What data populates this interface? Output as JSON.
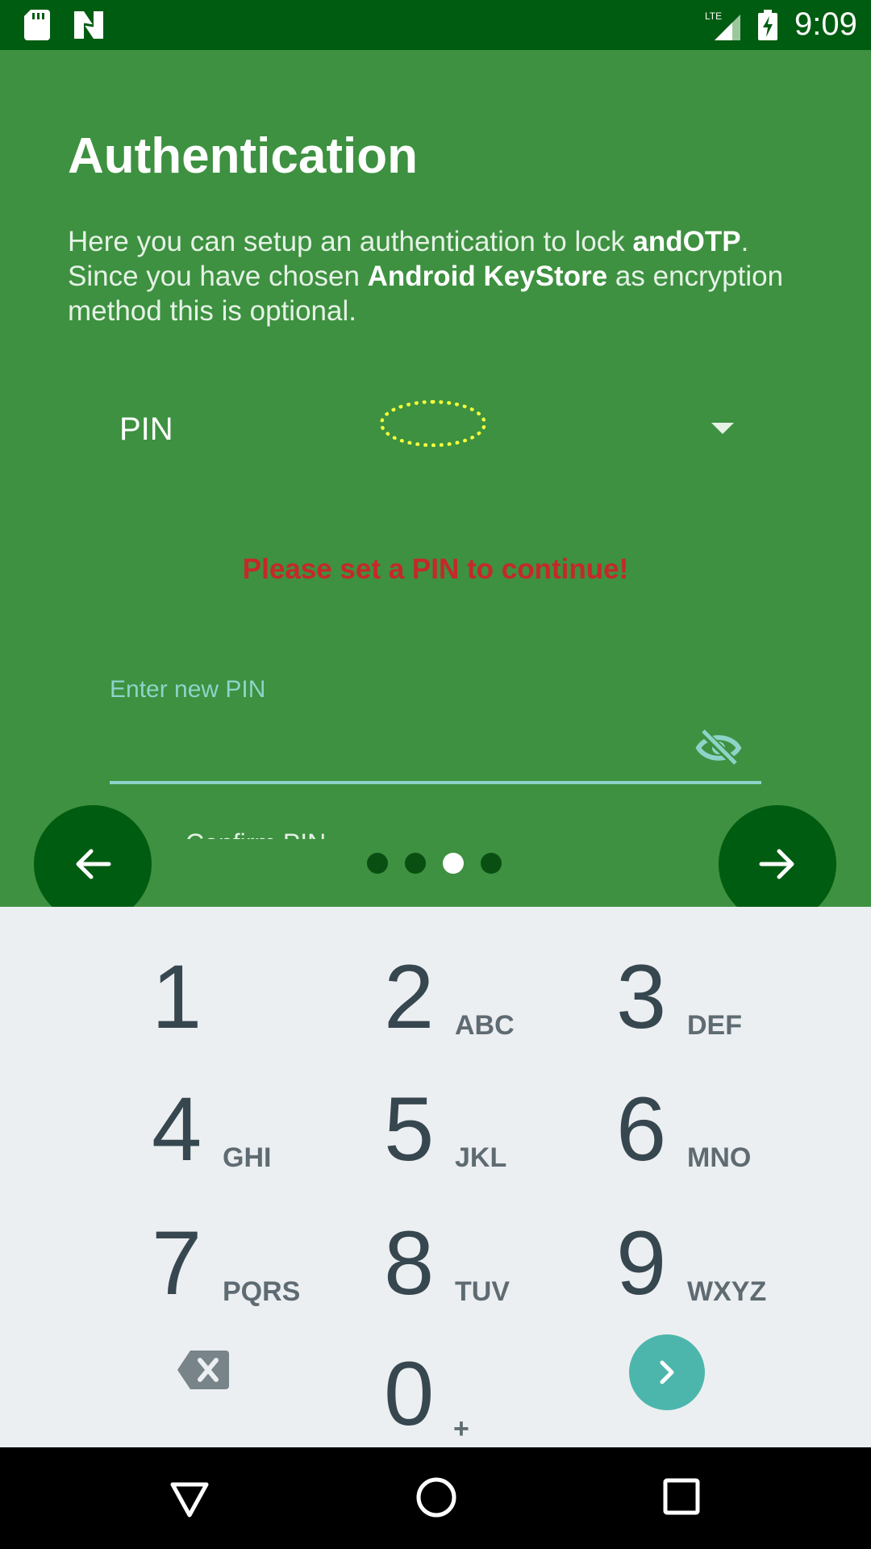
{
  "status_bar": {
    "time": "9:09",
    "icons": [
      "sd-card-icon",
      "n-icon",
      "lte-signal-icon",
      "battery-charging-icon"
    ]
  },
  "header": {
    "title": "Authentication",
    "description_parts": {
      "p1": "Here you can setup an authentication to lock ",
      "app": "andOTP",
      "p2": ". Since you have chosen ",
      "method": "Android KeyStore",
      "p3": " as encryption method this is optional."
    }
  },
  "auth_spinner": {
    "selected": "PIN"
  },
  "error_message": "Please set a PIN to continue!",
  "pin_field": {
    "hint": "Enter new PIN",
    "value": ""
  },
  "confirm_peek": "Confirm PIN",
  "pager": {
    "pages": 4,
    "current": 3
  },
  "keypad": {
    "keys": [
      {
        "num": "1",
        "letters": ""
      },
      {
        "num": "2",
        "letters": "ABC"
      },
      {
        "num": "3",
        "letters": "DEF"
      },
      {
        "num": "4",
        "letters": "GHI"
      },
      {
        "num": "5",
        "letters": "JKL"
      },
      {
        "num": "6",
        "letters": "MNO"
      },
      {
        "num": "7",
        "letters": "PQRS"
      },
      {
        "num": "8",
        "letters": "TUV"
      },
      {
        "num": "9",
        "letters": "WXYZ"
      },
      {
        "num": "0",
        "letters": "+"
      }
    ]
  },
  "colors": {
    "primary": "#3d9140",
    "primary_dark": "#005c11",
    "accent": "#4db6ac",
    "error": "#c62828",
    "keypad_bg": "#eceff1"
  }
}
